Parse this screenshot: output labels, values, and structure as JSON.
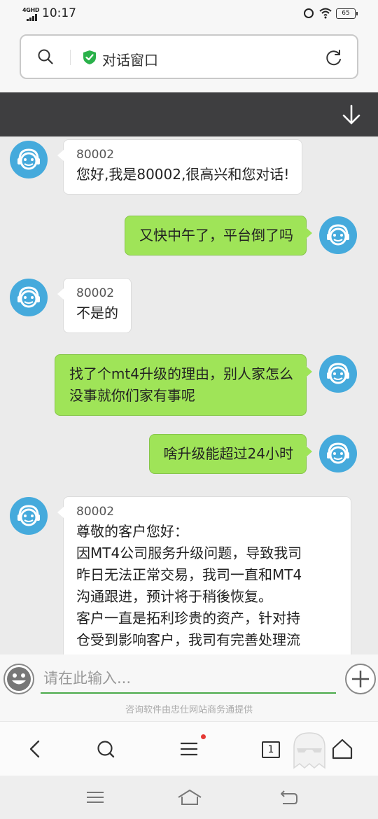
{
  "status_bar": {
    "network": "4GHD",
    "time": "10:17",
    "battery": "65"
  },
  "address_bar": {
    "title": "对话窗口"
  },
  "messages": [
    {
      "side": "in",
      "sender": "80002",
      "lines": [
        "您好,我是80002,很高兴和您对话!"
      ]
    },
    {
      "side": "out",
      "lines": [
        "又快中午了，平台倒了吗"
      ]
    },
    {
      "side": "in",
      "sender": "80002",
      "lines": [
        "不是的"
      ]
    },
    {
      "side": "out",
      "lines": [
        "找了个mt4升级的理由，别人家怎么",
        "没事就你们家有事呢"
      ]
    },
    {
      "side": "out",
      "lines": [
        "啥升级能超过24小时"
      ]
    },
    {
      "side": "in",
      "sender": "80002",
      "lines": [
        "尊敬的客户您好：",
        "因MT4公司服务升级问题，导致我司",
        "昨日无法正常交易，我司一直和MT4",
        "沟通跟进，预计将于稍後恢复。",
        "客户一直是拓利珍贵的资产，针对持",
        "仓受到影响客户，我司有完善处理流"
      ]
    }
  ],
  "input": {
    "placeholder": "请在此输入..."
  },
  "footer": {
    "credit": "咨询软件由忠仕网站商务通提供"
  },
  "browser_nav": {
    "tab_count": "1"
  },
  "colors": {
    "accent_green": "#9fe458",
    "avatar_blue": "#45aadc",
    "dark_bar": "#3e3e40"
  }
}
